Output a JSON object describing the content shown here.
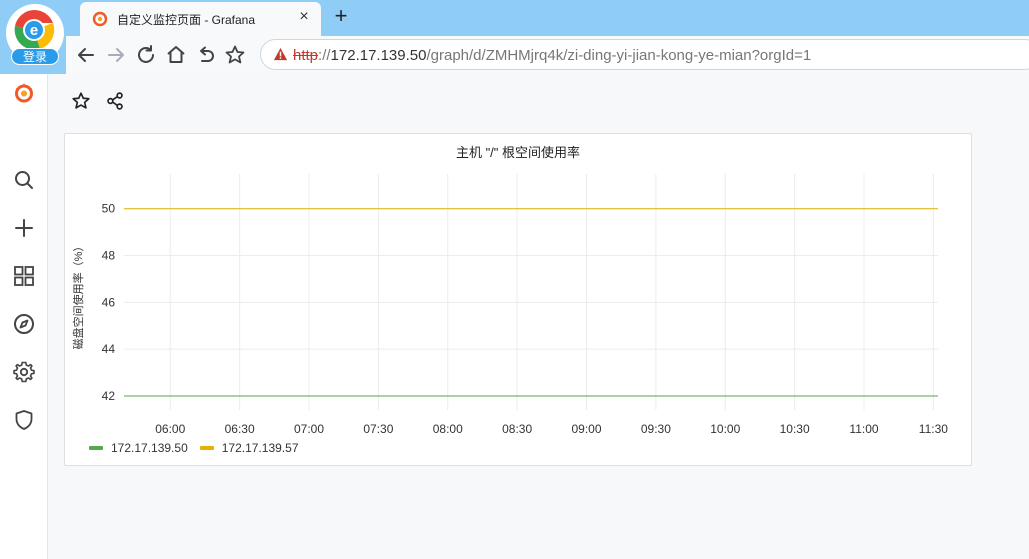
{
  "browser": {
    "login_badge": "登录",
    "tab_title": "自定义监控页面 - Grafana",
    "tab_close": "×",
    "new_tab": "+",
    "url_scheme": "http",
    "url_sep": "://",
    "url_host": "172.17.139.50",
    "url_path": "/graph/d/ZMHMjrq4k/zi-ding-yi-jian-kong-ye-mian?orgId=1"
  },
  "panel": {
    "title": "主机 \"/\" 根空间使用率",
    "colors": {
      "series1": "#56a64b",
      "series2": "#e0b400"
    }
  },
  "chart_data": {
    "type": "line",
    "ylabel": "磁盘空间使用率（%）",
    "ylim": [
      41.4,
      50.8
    ],
    "yticks": [
      42,
      44,
      46,
      48,
      50
    ],
    "xticks": [
      "06:00",
      "06:30",
      "07:00",
      "07:30",
      "08:00",
      "08:30",
      "09:00",
      "09:30",
      "10:00",
      "10:30",
      "11:00",
      "11:30"
    ],
    "x_range": [
      "05:40",
      "11:32"
    ],
    "grid": true,
    "legend": "bottom-left",
    "series": [
      {
        "name": "172.17.139.50",
        "color": "#56a64b",
        "x": [
          "05:40",
          "11:32"
        ],
        "values": [
          42,
          42
        ]
      },
      {
        "name": "172.17.139.57",
        "color": "#e0b400",
        "x": [
          "05:40",
          "11:32"
        ],
        "values": [
          50,
          50
        ]
      }
    ]
  }
}
